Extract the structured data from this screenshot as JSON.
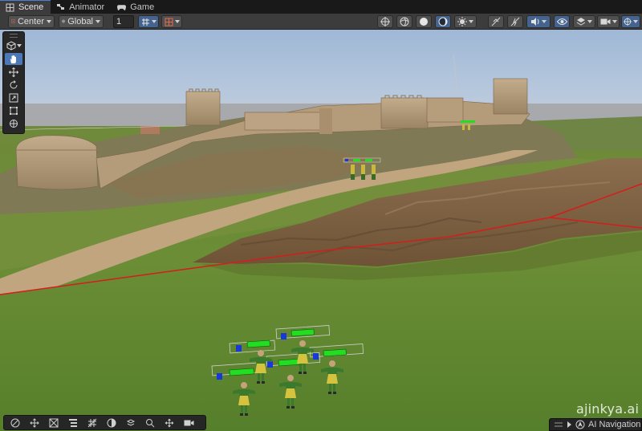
{
  "tabs": [
    {
      "label": "Scene",
      "icon": "scene-grid-icon",
      "active": true
    },
    {
      "label": "Animator",
      "icon": "animator-icon",
      "active": false
    },
    {
      "label": "Game",
      "icon": "gamepad-icon",
      "active": false
    }
  ],
  "toolbar": {
    "pivot_label": "Center",
    "space_label": "Global",
    "grid_snap_value": "1",
    "right_icons": [
      "draw-mode-icon",
      "shading-wireframe-icon",
      "shading-solid-icon",
      "shading-lit-icon",
      "effects-icon",
      "2d-toggle-icon",
      "lighting-toggle-icon",
      "audio-toggle-icon",
      "visibility-icon",
      "layers-icon",
      "camera-icon",
      "gizmos-icon"
    ]
  },
  "tools": [
    "hand-tool-icon",
    "move-tool-icon",
    "rotate-tool-icon",
    "scale-tool-icon",
    "rect-tool-icon",
    "transform-tool-icon"
  ],
  "bottom_tools": [
    "navmesh-icon",
    "move-icon",
    "constraint-icon",
    "hierarchy-icon",
    "grid-icon",
    "lighting-icon",
    "cube-layers-icon",
    "search-icon",
    "move-arrows-icon",
    "camera-icon"
  ],
  "ai_navigation": {
    "label": "AI Navigation"
  },
  "watermark": "ajinkya.ai",
  "colors": {
    "accent": "#4a7fd1",
    "health_bar": "#22dd22",
    "team_marker": "#1838d8",
    "path_line": "#d61c1c"
  }
}
